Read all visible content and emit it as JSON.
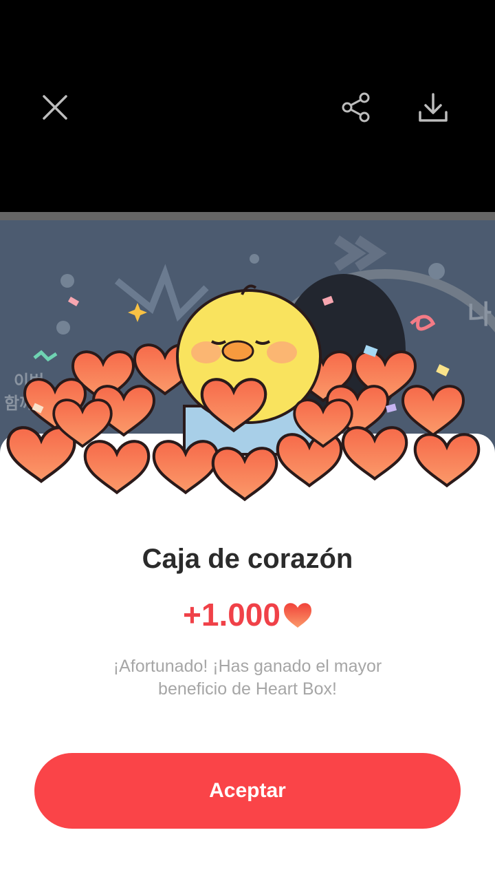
{
  "toolbar": {
    "close_icon": "close-icon",
    "share_icon": "share-icon",
    "download_icon": "download-icon"
  },
  "background": {
    "text_right": "나",
    "text_left_1": "이번",
    "text_left_2": "함께"
  },
  "dialog": {
    "title": "Caja de corazón",
    "amount": "+1.000",
    "amount_icon": "heart-icon",
    "description": "¡Afortunado! ¡Has ganado el mayor beneficio de Heart Box!",
    "accept_label": "Aceptar"
  },
  "colors": {
    "accent": "#fa4448",
    "amount": "#f04148"
  }
}
